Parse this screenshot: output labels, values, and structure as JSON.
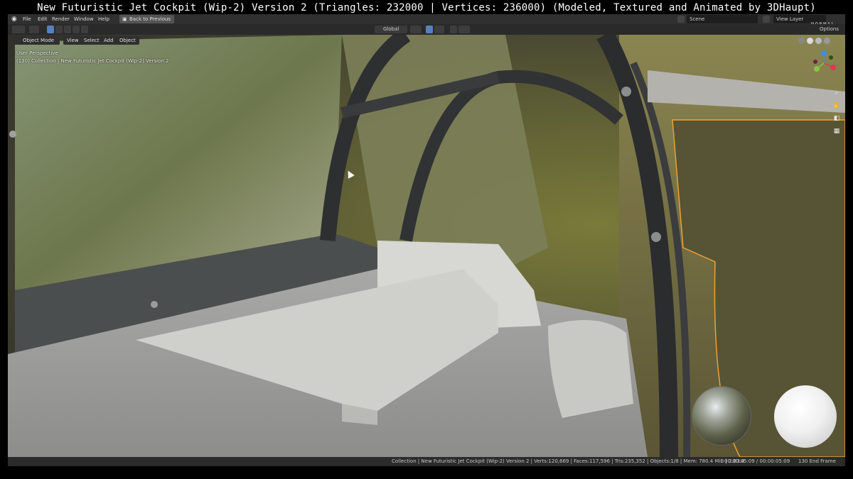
{
  "video_title": "New Futuristic Jet Cockpit (Wip-2) Version 2 (Triangles: 232000 | Vertices: 236000)  (Modeled, Textured and Animated by 3DHaupt)",
  "menubar": {
    "items": [
      "File",
      "Edit",
      "Render",
      "Window",
      "Help"
    ],
    "back_button": "Back to Previous",
    "scene": "Scene",
    "view_layer": "View Layer",
    "tag": "NORMAL"
  },
  "toolheader": {
    "orientation": "Global",
    "options": "Options"
  },
  "viewport": {
    "mode": "Object Mode",
    "menu": [
      "View",
      "Select",
      "Add",
      "Object"
    ],
    "overlay_line1": "User Perspective",
    "overlay_line2": "(130) Collection | New Futuristic Jet Cockpit (Wip-2) Version 2",
    "gizmo": {
      "x": "X",
      "y": "Y",
      "z": "Z"
    },
    "nav_icons": [
      "zoom-icon",
      "pan-hand-icon",
      "camera-icon",
      "grid-icon"
    ]
  },
  "statusbar": {
    "stats": "Collection | New Futuristic Jet Cockpit (Wip-2) Version 2 | Verts:120,669 | Faces:117,596 | Tris:235,352 | Objects:1/8 | Mem: 780.4 MiB | 2.83.4",
    "time": "00:00:05:09 / 00:00:05:09",
    "frame": "130 End Frame"
  },
  "colors": {
    "accent": "#5680c2",
    "selection_outline": "#f0a030",
    "gizmo_x": "#e0394f",
    "gizmo_y": "#8bc34a",
    "gizmo_z": "#3d8fe0"
  }
}
